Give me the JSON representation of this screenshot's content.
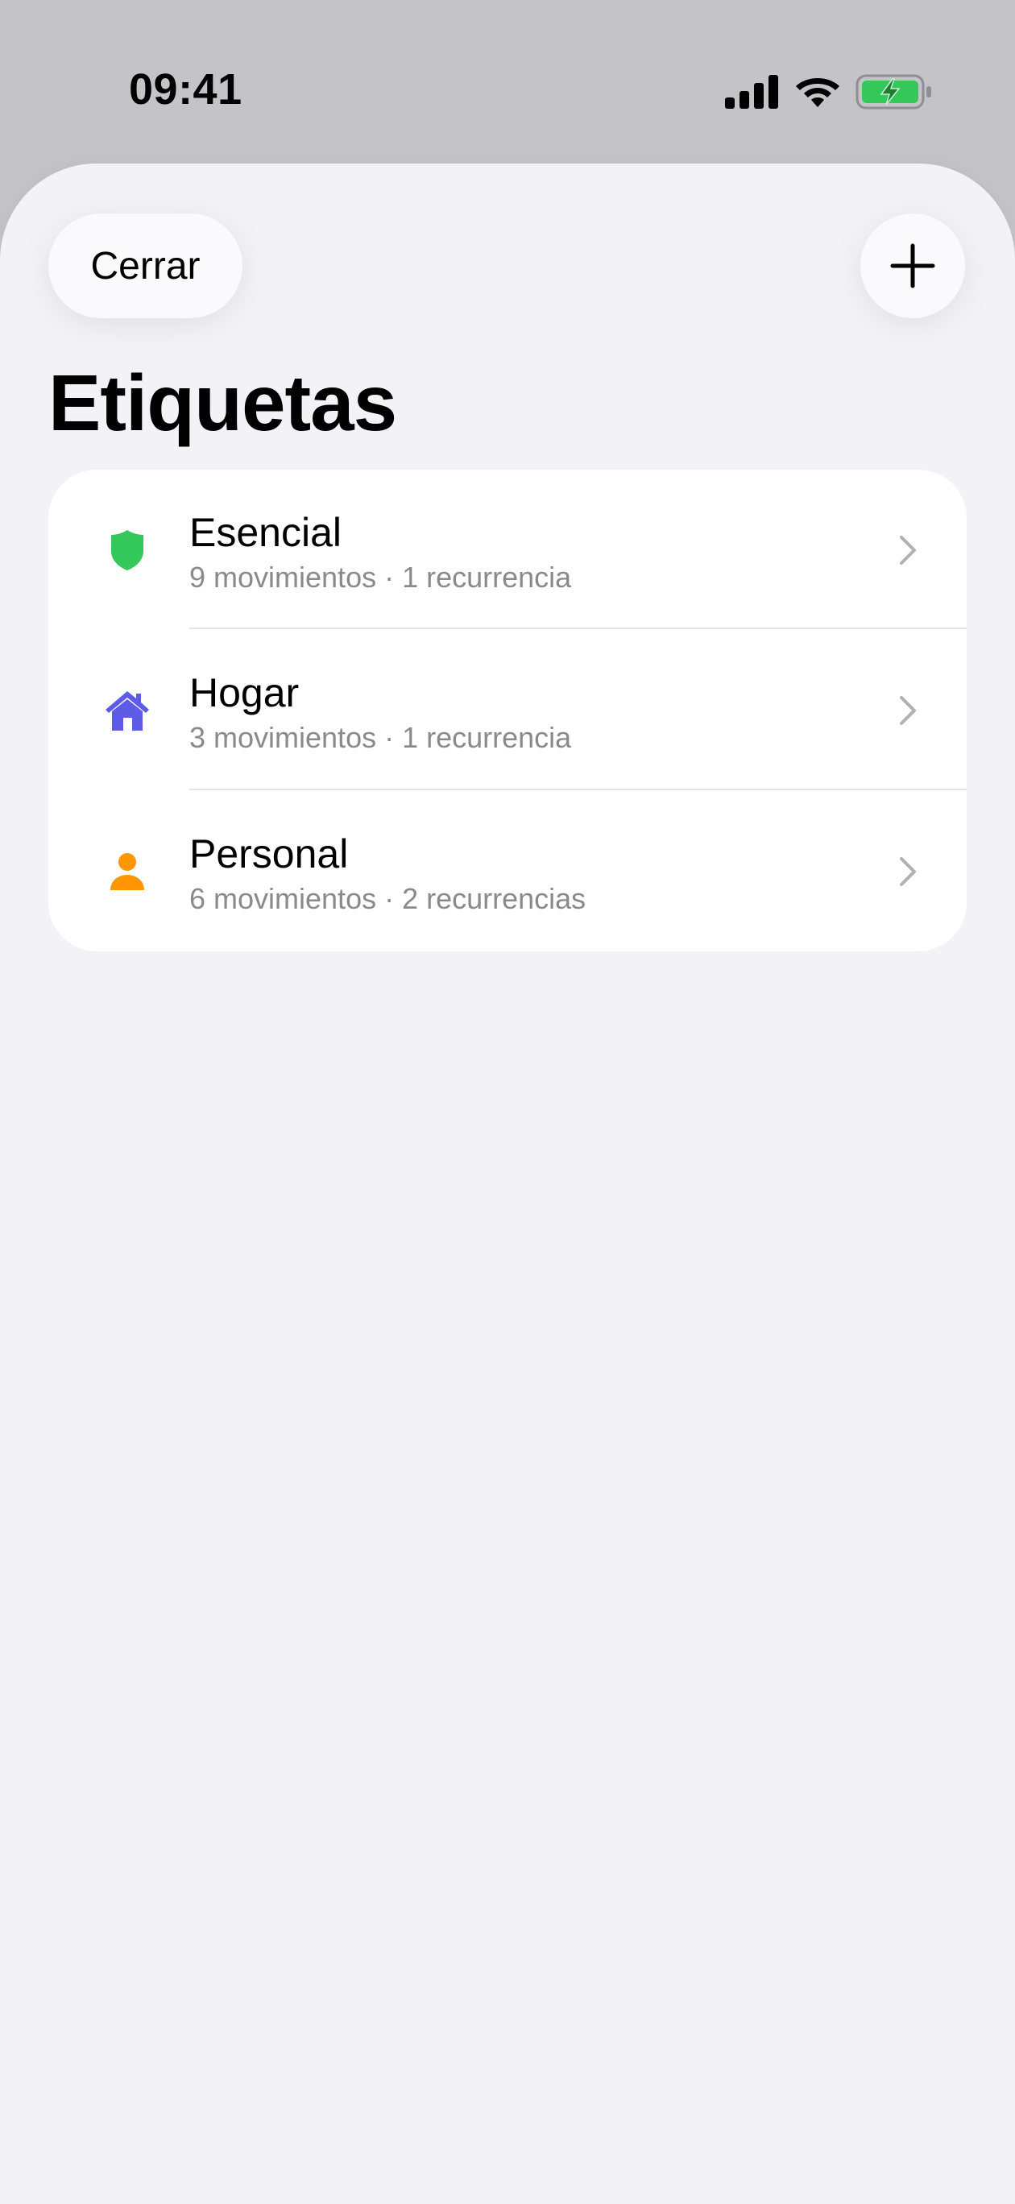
{
  "status_bar": {
    "time": "09:41",
    "icons": [
      "cellular-signal-icon",
      "wifi-icon",
      "battery-charging-icon"
    ],
    "battery_color": "#34c759"
  },
  "header": {
    "close_label": "Cerrar",
    "add_icon": "plus-icon",
    "title": "Etiquetas"
  },
  "tags": [
    {
      "name": "Esencial",
      "meta": "9 movimientos · 1 recurrencia",
      "icon": "shield-icon",
      "color": "#34c759"
    },
    {
      "name": "Hogar",
      "meta": "3 movimientos · 1 recurrencia",
      "icon": "house-icon",
      "color": "#5e5ce6"
    },
    {
      "name": "Personal",
      "meta": "6 movimientos · 2 recurrencias",
      "icon": "person-icon",
      "color": "#ff9500"
    }
  ]
}
